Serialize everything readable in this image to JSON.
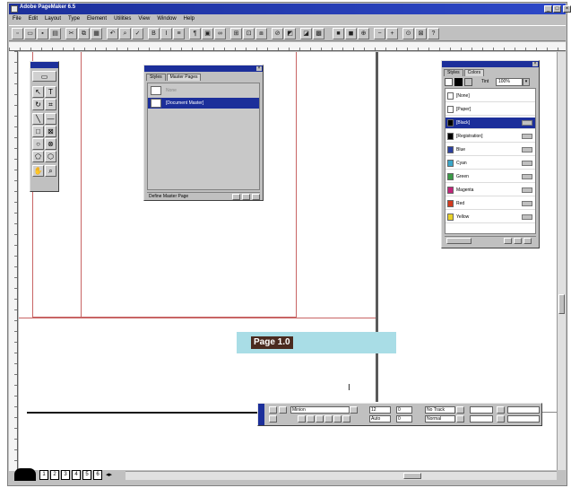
{
  "app": {
    "title": "Adobe PageMaker 6.5"
  },
  "menu": [
    "File",
    "Edit",
    "Layout",
    "Type",
    "Element",
    "Utilities",
    "View",
    "Window",
    "Help"
  ],
  "toolbox": {
    "tools": [
      "pointer-tool",
      "text-tool",
      "rotate-tool",
      "crop-tool",
      "line-tool",
      "constrained-line-tool",
      "rectangle-tool",
      "rectangle-frame-tool",
      "ellipse-tool",
      "ellipse-frame-tool",
      "polygon-tool",
      "polygon-frame-tool",
      "hand-tool",
      "zoom-tool"
    ]
  },
  "master_pages": {
    "tabs": [
      "Styles",
      "Master Pages"
    ],
    "items": [
      {
        "label": "None",
        "selected": false
      },
      {
        "label": "[Document Master]",
        "selected": true
      }
    ],
    "footer": "Define Master Page"
  },
  "colors_palette": {
    "tabs": [
      "Styles",
      "Colors"
    ],
    "tint_label": "Tint",
    "tint_value": "100%",
    "items": [
      {
        "name": "[None]",
        "swatch": "#ffffff",
        "selected": false
      },
      {
        "name": "[Paper]",
        "swatch": "#ffffff",
        "selected": false
      },
      {
        "name": "[Black]",
        "swatch": "#000000",
        "selected": true
      },
      {
        "name": "[Registration]",
        "swatch": "#000000",
        "selected": false
      },
      {
        "name": "Blue",
        "swatch": "#2a3f9e",
        "selected": false
      },
      {
        "name": "Cyan",
        "swatch": "#3aa6c8",
        "selected": false
      },
      {
        "name": "Green",
        "swatch": "#3a9a46",
        "selected": false
      },
      {
        "name": "Magenta",
        "swatch": "#c2247a",
        "selected": false
      },
      {
        "name": "Red",
        "swatch": "#d23a1e",
        "selected": false
      },
      {
        "name": "Yellow",
        "swatch": "#e8d22a",
        "selected": false
      }
    ]
  },
  "page_tab": {
    "label": "Page 1.0"
  },
  "control_palette": {
    "font": "Minion",
    "size": "12",
    "leading": "Auto",
    "tracking": "No Track",
    "width": "Normal",
    "kern": "0",
    "baseline": "0",
    "apply": "Apply"
  },
  "page_buttons": {
    "count": 6,
    "labels": [
      "1",
      "2",
      "3",
      "4",
      "5",
      "6"
    ]
  }
}
